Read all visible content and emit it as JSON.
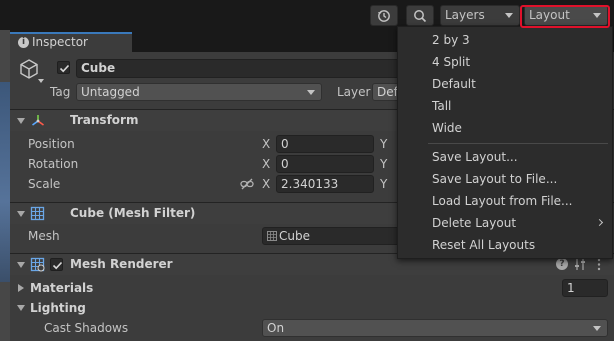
{
  "toolbar": {
    "layers_label": "Layers",
    "layout_label": "Layout",
    "highlight_color": "#e0112b"
  },
  "tab": {
    "label": "Inspector"
  },
  "object": {
    "name": "Cube",
    "active": true,
    "tag_label": "Tag",
    "tag_value": "Untagged",
    "layer_label": "Layer",
    "layer_value": "Def"
  },
  "transform": {
    "title": "Transform",
    "position_label": "Position",
    "position_x": "0",
    "rotation_label": "Rotation",
    "rotation_x": "0",
    "scale_label": "Scale",
    "scale_x": "2.340133",
    "x_axis": "X",
    "y_axis": "Y"
  },
  "mesh_filter": {
    "title": "Cube (Mesh Filter)",
    "mesh_label": "Mesh",
    "mesh_value": "Cube"
  },
  "mesh_renderer": {
    "title": "Mesh Renderer",
    "enabled": true,
    "materials_label": "Materials",
    "materials_count": "1",
    "lighting_label": "Lighting",
    "cast_shadows_label": "Cast Shadows",
    "cast_shadows_value": "On"
  },
  "layout_menu": {
    "items": [
      {
        "label": "2 by 3"
      },
      {
        "label": "4 Split"
      },
      {
        "label": "Default"
      },
      {
        "label": "Tall"
      },
      {
        "label": "Wide"
      },
      {
        "label": "Save Layout..."
      },
      {
        "label": "Save Layout to File..."
      },
      {
        "label": "Load Layout from File..."
      },
      {
        "label": "Delete Layout",
        "submenu": true
      },
      {
        "label": "Reset All Layouts"
      }
    ]
  },
  "colors": {
    "accent_blue": "#3a79bb",
    "panel_bg": "#3c3c3c",
    "menu_bg": "#2c2c2c"
  }
}
